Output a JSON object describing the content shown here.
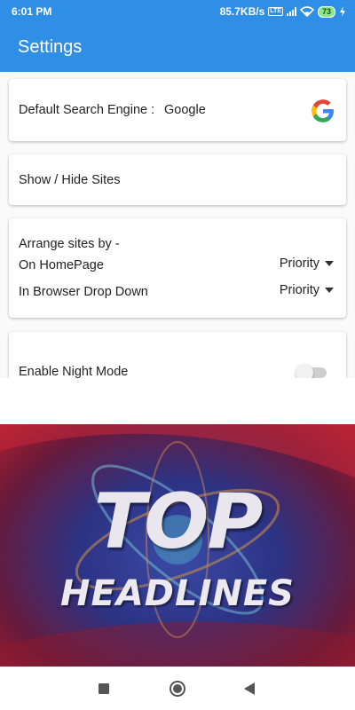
{
  "status": {
    "time": "6:01 PM",
    "network_speed": "85.7KB/s",
    "network_type": "LTE",
    "battery": "73"
  },
  "app": {
    "title": "Settings"
  },
  "settings": {
    "search_engine_label": "Default Search Engine :",
    "search_engine_value": "Google",
    "show_hide_sites": "Show / Hide Sites",
    "arrange_title": "Arrange sites by -",
    "homepage_label": "On HomePage",
    "homepage_value": "Priority",
    "dropdown_label": "In Browser Drop Down",
    "dropdown_value": "Priority",
    "night_mode_label": "Enable Night Mode",
    "night_mode_enabled": false
  },
  "banner": {
    "line1": "TOP",
    "line2": "HEADLINES"
  },
  "colors": {
    "appbar": "#2f8ee6",
    "banner_edge": "#b01e2c",
    "banner_center": "#3b4aa6"
  },
  "icons": {
    "google": "google-g-icon",
    "wifi": "wifi-icon",
    "signal": "signal-icon",
    "charging": "charging-icon",
    "caret": "dropdown-caret-icon",
    "nav_recents": "recents-square-icon",
    "nav_home": "home-circle-icon",
    "nav_back": "back-triangle-icon"
  }
}
